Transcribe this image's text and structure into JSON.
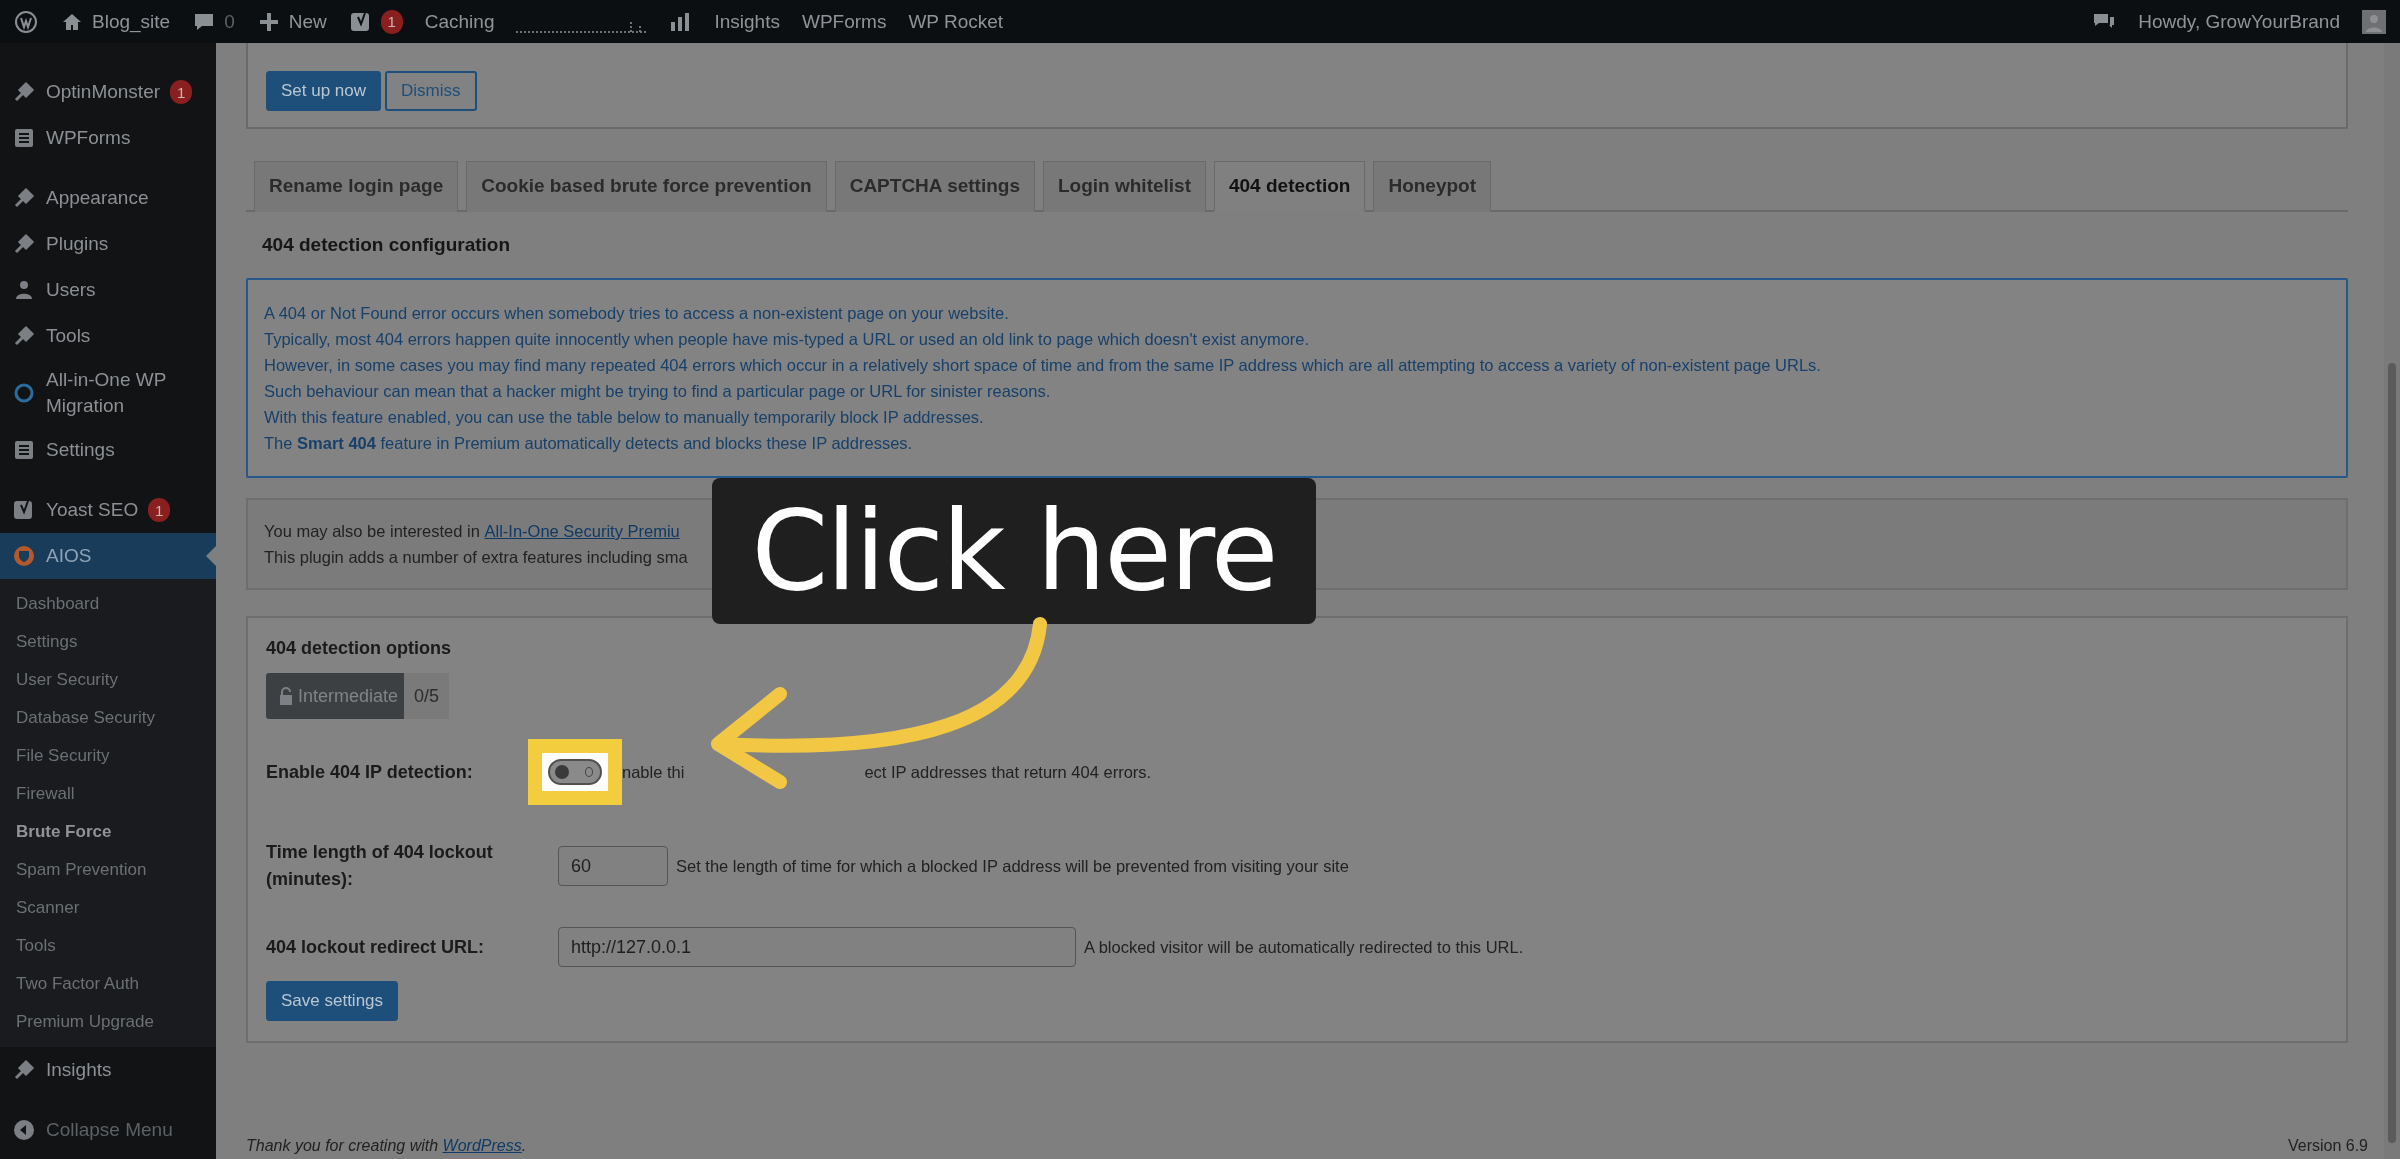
{
  "admin_bar": {
    "site": "Blog_site",
    "comments": "0",
    "new": "New",
    "yoast_badge": "1",
    "links": [
      "Caching",
      "Insights",
      "WPForms",
      "WP Rocket"
    ],
    "greeting": "Howdy, GrowYourBrand"
  },
  "sidebar": {
    "groups": [
      [
        {
          "label": "OptinMonster",
          "badge": "1",
          "selected": false
        },
        {
          "label": "WPForms",
          "selected": false
        }
      ],
      [
        {
          "label": "Appearance",
          "selected": false
        },
        {
          "label": "Plugins",
          "selected": false
        },
        {
          "label": "Users",
          "selected": false
        },
        {
          "label": "Tools",
          "selected": false
        },
        {
          "label": "All-in-One WP Migration",
          "selected": false
        },
        {
          "label": "Settings",
          "selected": false
        }
      ],
      [
        {
          "label": "Yoast SEO",
          "badge": "1",
          "selected": false
        },
        {
          "label": "AIOS",
          "selected": true,
          "submenu": [
            {
              "label": "Dashboard",
              "selected": false
            },
            {
              "label": "Settings",
              "selected": false
            },
            {
              "label": "User Security",
              "selected": false
            },
            {
              "label": "Database Security",
              "selected": false
            },
            {
              "label": "File Security",
              "selected": false
            },
            {
              "label": "Firewall",
              "selected": false
            },
            {
              "label": "Brute Force",
              "selected": true
            },
            {
              "label": "Spam Prevention",
              "selected": false
            },
            {
              "label": "Scanner",
              "selected": false
            },
            {
              "label": "Tools",
              "selected": false
            },
            {
              "label": "Two Factor Auth",
              "selected": false
            },
            {
              "label": "Premium Upgrade",
              "selected": false
            }
          ]
        },
        {
          "label": "Insights",
          "selected": false
        }
      ]
    ],
    "collapse": "Collapse Menu"
  },
  "notice": {
    "buttons": [
      "Set up now",
      "Dismiss"
    ]
  },
  "tabs": [
    {
      "label": "Rename login page",
      "selected": false
    },
    {
      "label": "Cookie based brute force prevention",
      "selected": false
    },
    {
      "label": "CAPTCHA settings",
      "selected": false
    },
    {
      "label": "Login whitelist",
      "selected": false
    },
    {
      "label": "404 detection",
      "selected": true
    },
    {
      "label": "Honeypot",
      "selected": false
    }
  ],
  "section_title": "404 detection configuration",
  "info_lines": [
    "A 404 or Not Found error occurs when somebody tries to access a non-existent page on your website.",
    "Typically, most 404 errors happen quite innocently when people have mis-typed a URL or used an old link to page which doesn't exist anymore.",
    "However, in some cases you may find many repeated 404 errors which occur in a relatively short space of time and from the same IP address which are all attempting to access a variety of non-existent page URLs.",
    "Such behaviour can mean that a hacker might be trying to find a particular page or URL for sinister reasons.",
    "With this feature enabled, you can use the table below to manually temporarily block IP addresses.",
    "The **Smart 404** feature in Premium automatically detects and blocks these IP addresses."
  ],
  "premium_note": {
    "prefix": "You may also be interested in",
    "link": "All-In-One Security Premiu",
    "line_2": "This plugin adds a number of extra features including sma"
  },
  "options": {
    "title": "404 detection options",
    "badge": "Intermediate",
    "score": "0/5",
    "fields": [
      {
        "kind": "toggle",
        "label": "Enable 404 IP detection:",
        "on": false,
        "description_parts": [
          "nable thi",
          "ect IP addresses that return 404 errors."
        ]
      },
      {
        "kind": "number",
        "label": "Time length of 404 lockout (minutes):",
        "value": "60",
        "description": "Set the length of time for which a blocked IP address will be prevented from visiting your site"
      },
      {
        "kind": "url",
        "label": "404 lockout redirect URL:",
        "value": "http://127.0.0.1",
        "description": "A blocked visitor will be automatically redirected to this URL."
      }
    ],
    "save": "Save settings"
  },
  "footer": {
    "prefix": "Thank you for creating with",
    "link": "WordPress",
    "suffix": "."
  },
  "version": "Version 6.9",
  "callout": {
    "text": "Click here"
  }
}
